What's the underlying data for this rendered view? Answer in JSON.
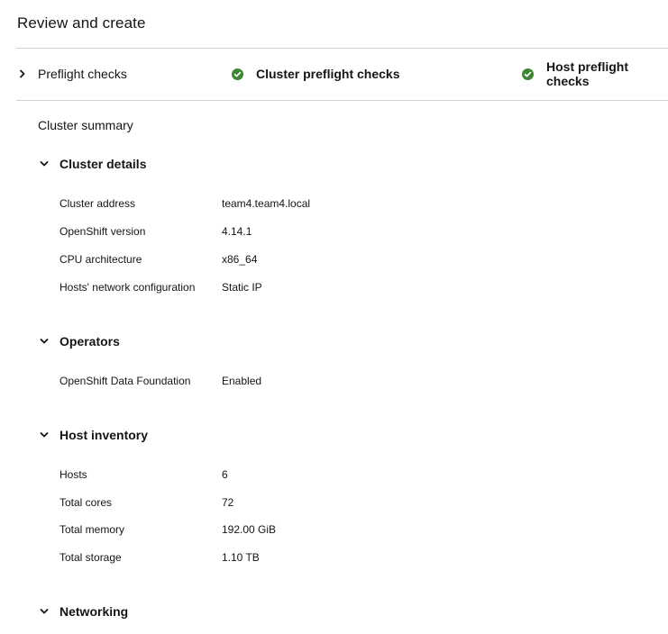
{
  "page": {
    "title": "Review and create"
  },
  "preflight": {
    "label": "Preflight checks",
    "cluster_checks": "Cluster preflight checks",
    "host_checks": "Host preflight checks",
    "status_icon": "check-circle-icon",
    "status_color": "#3e8635"
  },
  "summary": {
    "title": "Cluster summary",
    "sections": {
      "cluster_details": {
        "title": "Cluster details",
        "rows": [
          {
            "label": "Cluster address",
            "value": "team4.team4.local"
          },
          {
            "label": "OpenShift version",
            "value": "4.14.1"
          },
          {
            "label": "CPU architecture",
            "value": "x86_64"
          },
          {
            "label": "Hosts' network configuration",
            "value": "Static IP"
          }
        ]
      },
      "operators": {
        "title": "Operators",
        "rows": [
          {
            "label": "OpenShift Data Foundation",
            "value": "Enabled"
          }
        ]
      },
      "host_inventory": {
        "title": "Host inventory",
        "rows": [
          {
            "label": "Hosts",
            "value": "6"
          },
          {
            "label": "Total cores",
            "value": "72"
          },
          {
            "label": "Total memory",
            "value": "192.00 GiB"
          },
          {
            "label": "Total storage",
            "value": "1.10 TB"
          }
        ]
      },
      "networking": {
        "title": "Networking"
      }
    }
  }
}
